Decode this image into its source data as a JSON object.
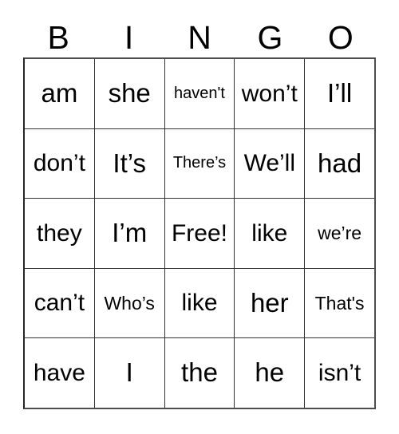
{
  "card": {
    "title": "BINGO",
    "header_letters": [
      "B",
      "I",
      "N",
      "G",
      "O"
    ],
    "background_color": "#ffffff",
    "text_color": "#000000",
    "border_color": "#333333",
    "rows": 5,
    "columns": 5,
    "free_space": "Free!",
    "free_space_position": "row3-col3"
  },
  "grid": {
    "rows": [
      {
        "cells": [
          {
            "text": "am",
            "size": "size-lg"
          },
          {
            "text": "she",
            "size": "size-lg"
          },
          {
            "text": "haven't",
            "size": "size-xs"
          },
          {
            "text": "won’t",
            "size": "size-md"
          },
          {
            "text": "I’ll",
            "size": "size-lg"
          }
        ]
      },
      {
        "cells": [
          {
            "text": "don’t",
            "size": "size-md"
          },
          {
            "text": "It’s",
            "size": "size-lg"
          },
          {
            "text": "There’s",
            "size": "size-xs"
          },
          {
            "text": "We’ll",
            "size": "size-md"
          },
          {
            "text": "had",
            "size": "size-lg"
          }
        ]
      },
      {
        "cells": [
          {
            "text": "they",
            "size": "size-md"
          },
          {
            "text": "I’m",
            "size": "size-lg"
          },
          {
            "text": "Free!",
            "size": "size-md"
          },
          {
            "text": "like",
            "size": "size-md"
          },
          {
            "text": "we’re",
            "size": "size-sm"
          }
        ]
      },
      {
        "cells": [
          {
            "text": "can’t",
            "size": "size-md"
          },
          {
            "text": "Who’s",
            "size": "size-sm"
          },
          {
            "text": "like",
            "size": "size-md"
          },
          {
            "text": "her",
            "size": "size-lg"
          },
          {
            "text": "That's",
            "size": "size-sm"
          }
        ]
      },
      {
        "cells": [
          {
            "text": "have",
            "size": "size-md"
          },
          {
            "text": "I",
            "size": "size-lg"
          },
          {
            "text": "the",
            "size": "size-lg"
          },
          {
            "text": "he",
            "size": "size-lg"
          },
          {
            "text": "isn’t",
            "size": "size-md"
          }
        ]
      }
    ]
  }
}
